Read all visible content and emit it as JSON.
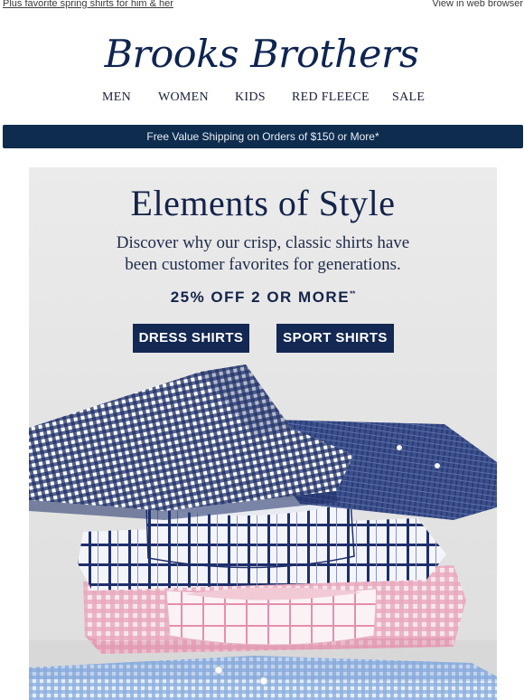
{
  "preheader": {
    "text": "Plus favorite spring shirts for him & her",
    "web_view": "View in web browser"
  },
  "brand": {
    "logo_text": "Brooks Brothers"
  },
  "nav": {
    "items": [
      "MEN",
      "WOMEN",
      "KIDS",
      "RED FLEECE",
      "SALE"
    ]
  },
  "shipping_banner": {
    "text": "Free Value Shipping on Orders of $150 or More*"
  },
  "hero": {
    "title": "Elements of Style",
    "subtitle_line1": "Discover why our crisp, classic shirts have",
    "subtitle_line2": "been customer favorites for generations.",
    "offer": "25% OFF 2 OR MORE",
    "offer_mark": "**",
    "buttons": {
      "dress": "DRESS SHIRTS",
      "sport": "SPORT SHIRTS"
    },
    "image": {
      "subject": "stack of folded shirts"
    }
  },
  "colors": {
    "navy": "#0e2c4e",
    "button": "#132852",
    "logo": "#0f2450",
    "hero_bg": "#e6e6e6"
  }
}
